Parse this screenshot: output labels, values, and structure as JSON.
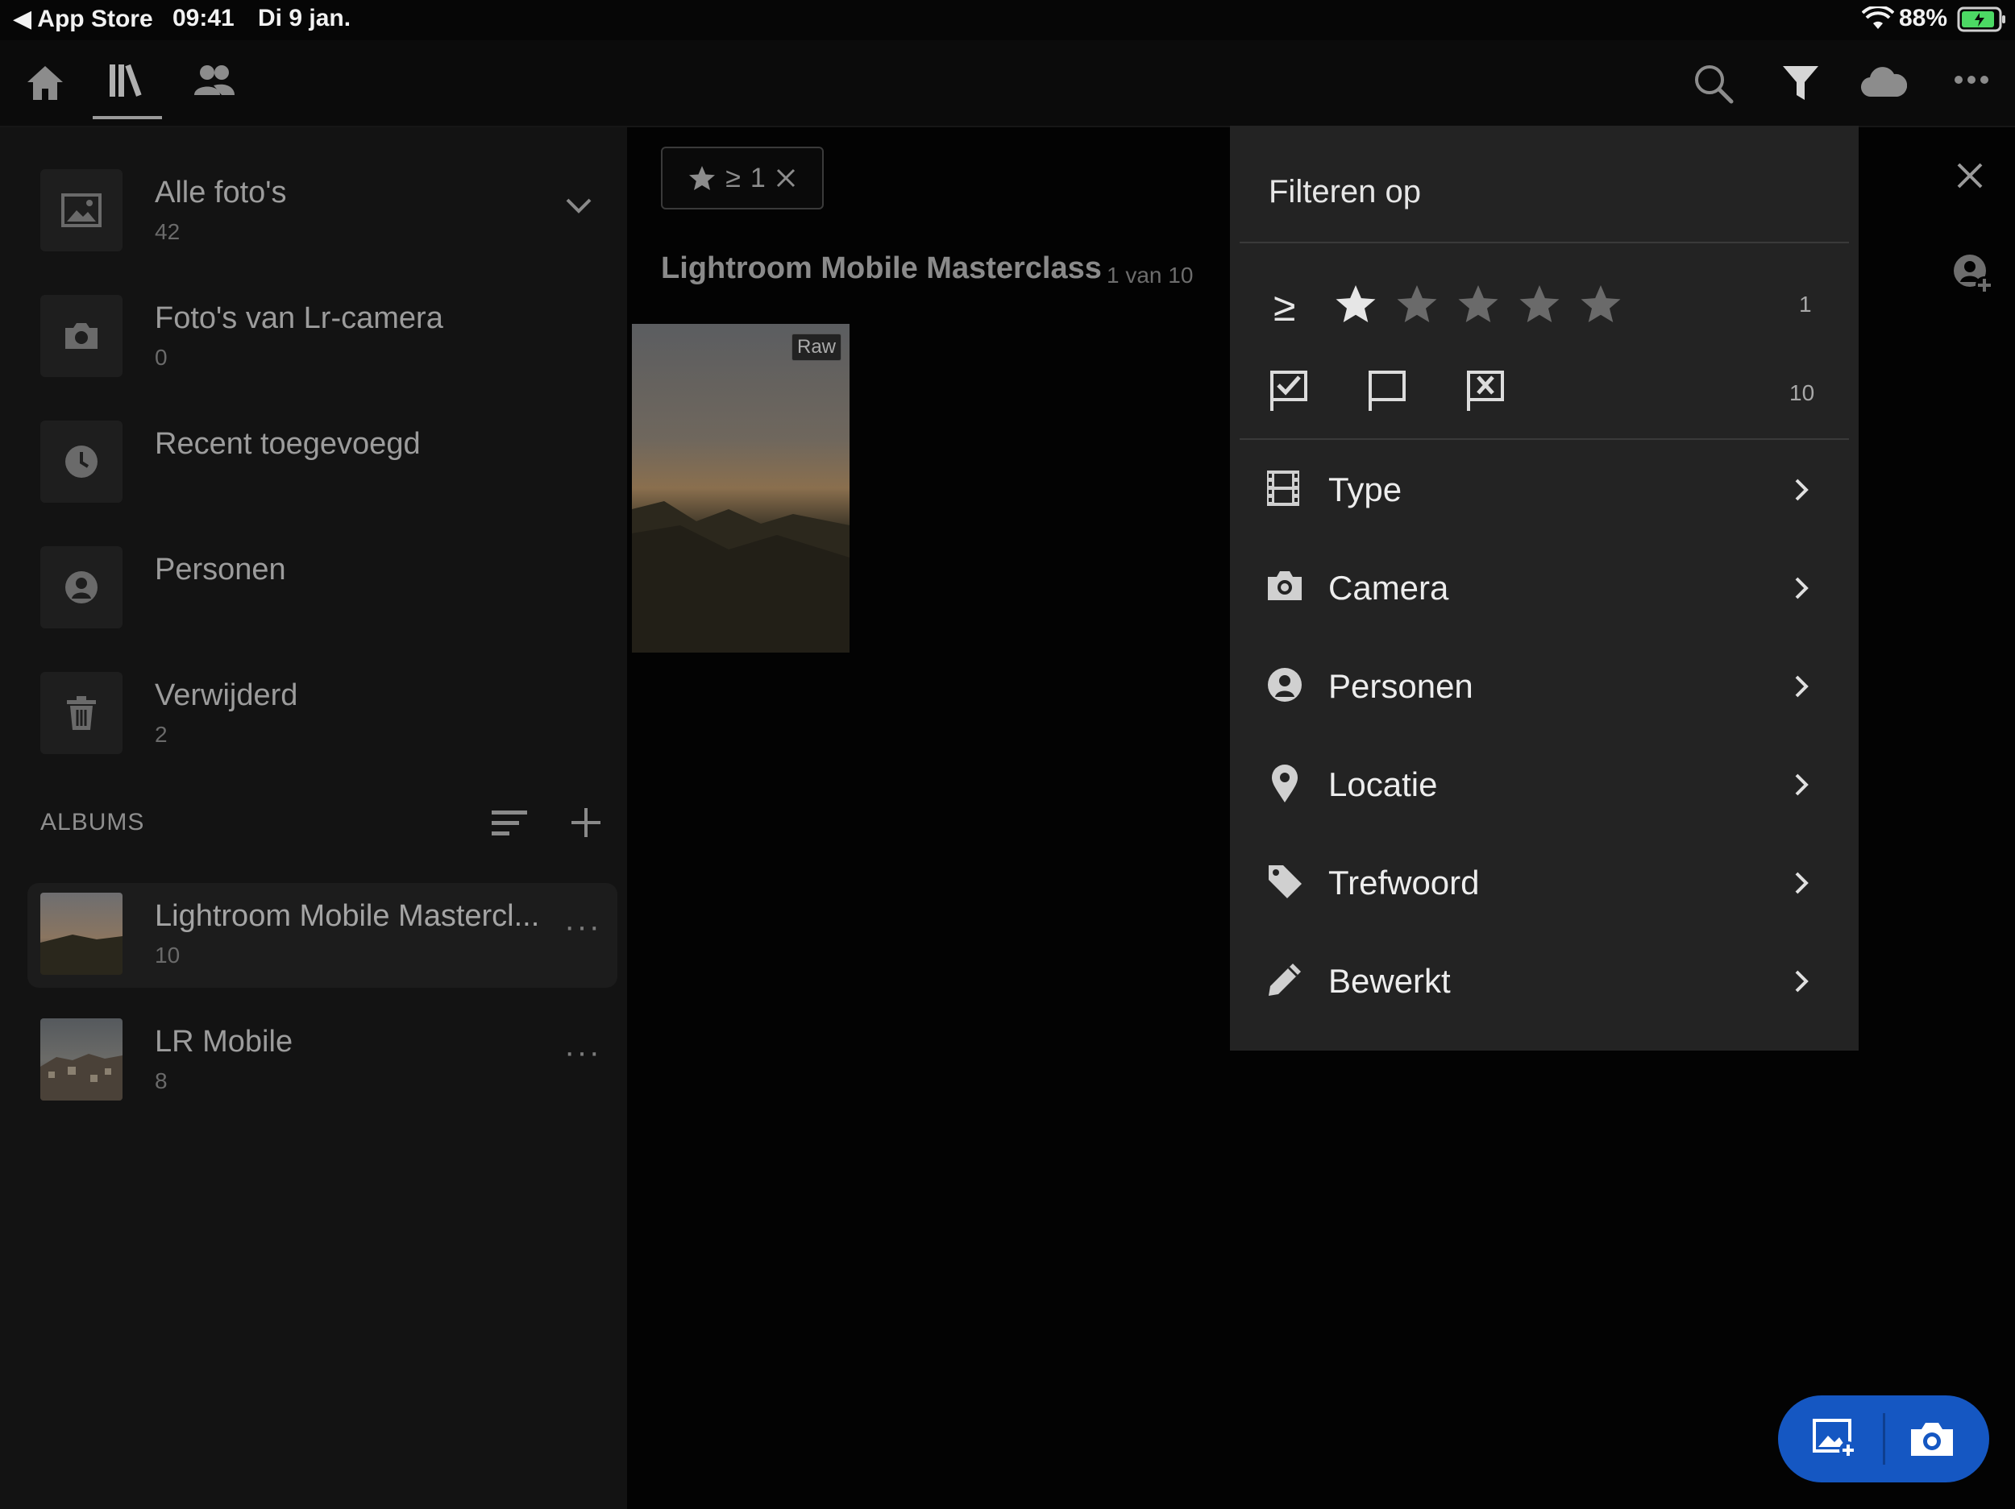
{
  "status_bar": {
    "back_app": "◀ App Store",
    "time": "09:41",
    "date": "Di 9 jan.",
    "battery": "88%"
  },
  "toolbar": {
    "left_icons": [
      "home-icon",
      "library-icon",
      "people-icon"
    ],
    "right_icons": [
      "search-icon",
      "filter-icon",
      "cloud-icon",
      "more-icon"
    ],
    "active_tab": "library"
  },
  "sidebar": {
    "items": [
      {
        "title": "Alle foto's",
        "count": "42",
        "icon": "photo-icon"
      },
      {
        "title": "Foto's van Lr-camera",
        "count": "0",
        "icon": "camera-icon"
      },
      {
        "title": "Recent toegevoegd",
        "count": "",
        "icon": "clock-icon"
      },
      {
        "title": "Personen",
        "count": "",
        "icon": "person-icon"
      },
      {
        "title": "Verwijderd",
        "count": "2",
        "icon": "trash-icon"
      }
    ],
    "albums_label": "ALBUMS",
    "albums": [
      {
        "title": "Lightroom Mobile Mastercl...",
        "count": "10",
        "selected": true
      },
      {
        "title": "LR Mobile",
        "count": "8",
        "selected": false
      }
    ]
  },
  "main": {
    "filter_chip": {
      "operator": "≥",
      "value": "1"
    },
    "album_title": "Lightroom Mobile Masterclass",
    "position": "1 van 10",
    "photo_badge": "Raw"
  },
  "filter_panel": {
    "title": "Filteren op",
    "rating_operator": "≥",
    "rating_value": 1,
    "rating_max": 5,
    "rating_count": "1",
    "flag_count": "10",
    "menu": [
      {
        "label": "Type",
        "icon": "film-icon"
      },
      {
        "label": "Camera",
        "icon": "camera-icon"
      },
      {
        "label": "Personen",
        "icon": "person-icon"
      },
      {
        "label": "Locatie",
        "icon": "location-pin-icon"
      },
      {
        "label": "Trefwoord",
        "icon": "tag-icon"
      },
      {
        "label": "Bewerkt",
        "icon": "pencil-icon"
      }
    ]
  },
  "colors": {
    "fab": "#1557c2",
    "panel": "#232323",
    "sidebar": "#131313",
    "battery": "#4cd964"
  }
}
